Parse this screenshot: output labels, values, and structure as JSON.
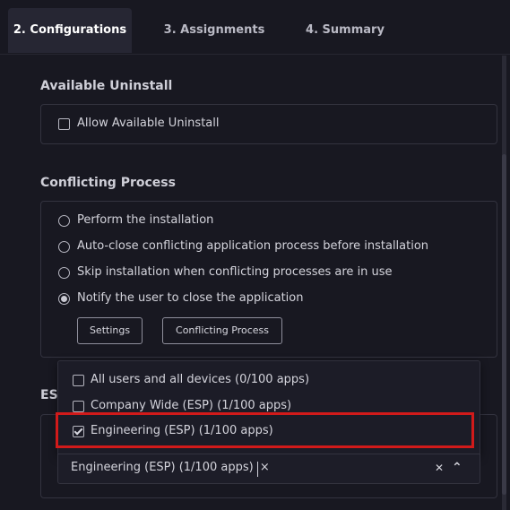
{
  "tabs": [
    {
      "label": "2. Configurations",
      "active": true
    },
    {
      "label": "3. Assignments",
      "active": false
    },
    {
      "label": "4. Summary",
      "active": false
    }
  ],
  "available_uninstall": {
    "title": "Available Uninstall",
    "checkbox_label": "Allow Available Uninstall",
    "checked": false
  },
  "conflicting_process": {
    "title": "Conflicting Process",
    "options": [
      {
        "label": "Perform the installation",
        "selected": false
      },
      {
        "label": "Auto-close conflicting application process before installation",
        "selected": false
      },
      {
        "label": "Skip installation when conflicting processes are in use",
        "selected": false
      },
      {
        "label": "Notify the user to close the application",
        "selected": true
      }
    ],
    "settings_button": "Settings",
    "conflicting_process_button": "Conflicting Process"
  },
  "esp": {
    "title_partial": "ESI",
    "dropdown_options": [
      {
        "label": "All users and all devices (0/100 apps)",
        "checked": false
      },
      {
        "label": "Company Wide (ESP) (1/100 apps)",
        "checked": false
      },
      {
        "label": "Engineering (ESP) (1/100 apps)",
        "checked": true
      }
    ],
    "selected_chip": "Engineering (ESP) (1/100 apps)",
    "chip_remove": "×",
    "clear_icon": "✕",
    "collapse_icon": "⌃"
  },
  "colors": {
    "background": "#181821",
    "highlight": "#d11a1a",
    "active_tab": "#262633"
  }
}
